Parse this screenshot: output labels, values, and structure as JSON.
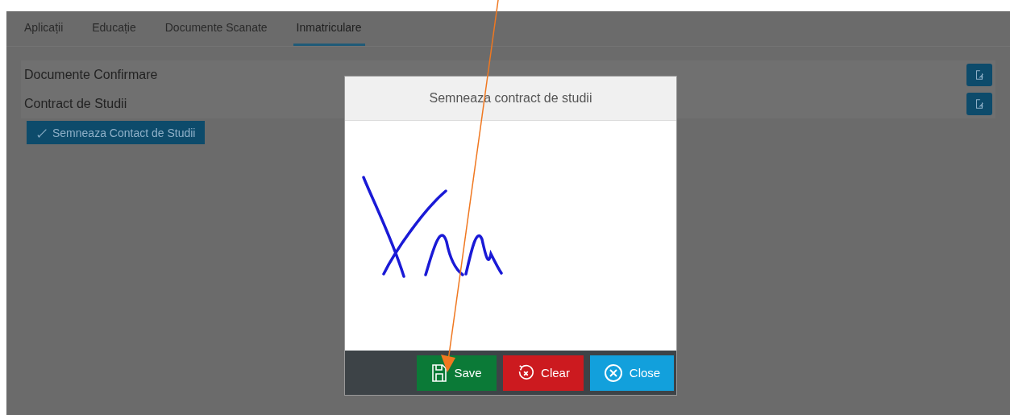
{
  "tabs": [
    {
      "label": "Aplicații",
      "selected": false
    },
    {
      "label": "Educație",
      "selected": false
    },
    {
      "label": "Documente Scanate",
      "selected": false
    },
    {
      "label": "Inmatriculare",
      "selected": true
    }
  ],
  "documents": [
    {
      "label": "Documente Confirmare"
    },
    {
      "label": "Contract de Studii"
    }
  ],
  "sign_button": "Semneaza Contact de Studii",
  "dialog": {
    "title": "Semneaza contract de studii",
    "buttons": [
      {
        "kind": "save",
        "label": "Save"
      },
      {
        "kind": "clear",
        "label": "Clear"
      },
      {
        "kind": "close",
        "label": "Close"
      }
    ]
  }
}
